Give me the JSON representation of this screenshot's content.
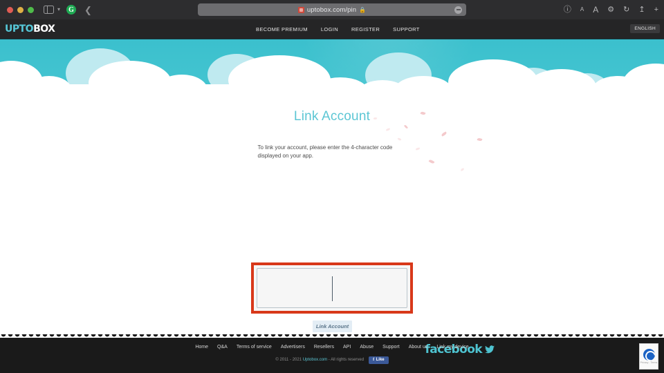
{
  "browser": {
    "url": "uptobox.com/pin",
    "lock_icon": "lock-icon",
    "back_icon": "back-chevron-icon",
    "sidebar_icon": "sidebar-toggle-icon",
    "profile_icon": "google-profile-icon",
    "toolbar_icons": [
      {
        "name": "privacy-report-icon",
        "glyph": "ⓘ"
      },
      {
        "name": "decrease-text-size-icon",
        "glyph": "A"
      },
      {
        "name": "increase-text-size-icon",
        "glyph": "A"
      },
      {
        "name": "extensions-icon",
        "glyph": "⚙"
      },
      {
        "name": "reload-icon",
        "glyph": "↻"
      },
      {
        "name": "share-icon",
        "glyph": "⇧"
      },
      {
        "name": "new-tab-icon",
        "glyph": "+"
      }
    ]
  },
  "site": {
    "logo_primary": "UPTO",
    "logo_secondary": "BOX",
    "nav": [
      {
        "label": "BECOME PREMIUM",
        "name": "nav-become-premium"
      },
      {
        "label": "LOGIN",
        "name": "nav-login"
      },
      {
        "label": "REGISTER",
        "name": "nav-register"
      },
      {
        "label": "SUPPORT",
        "name": "nav-support"
      }
    ],
    "language": "ENGLISH"
  },
  "main": {
    "title": "Link Account",
    "description": "To link your account, please enter the 4-character code displayed on your app.",
    "pin_value": "",
    "pin_placeholder": "",
    "submit_label": "Link Account",
    "highlight_color": "#d8381a",
    "title_color": "#5cc6d4"
  },
  "footer": {
    "links": [
      {
        "label": "Home",
        "name": "footer-link-home"
      },
      {
        "label": "Q&A",
        "name": "footer-link-qa"
      },
      {
        "label": "Terms of service",
        "name": "footer-link-terms"
      },
      {
        "label": "Advertisers",
        "name": "footer-link-advertisers"
      },
      {
        "label": "Resellers",
        "name": "footer-link-resellers"
      },
      {
        "label": "API",
        "name": "footer-link-api"
      },
      {
        "label": "Abuse",
        "name": "footer-link-abuse"
      },
      {
        "label": "Support",
        "name": "footer-link-support"
      },
      {
        "label": "About us",
        "name": "footer-link-about"
      },
      {
        "label": "Link my device",
        "name": "footer-link-link-my-device"
      }
    ],
    "copyright_prefix": "© 2011 - 2021 ",
    "copyright_brand": "Uptobox.com",
    "copyright_suffix": " - All rights reserved",
    "fb_like_label": "Like",
    "facebook_brand": "facebook",
    "recaptcha_text": "Privacy - Terms"
  }
}
